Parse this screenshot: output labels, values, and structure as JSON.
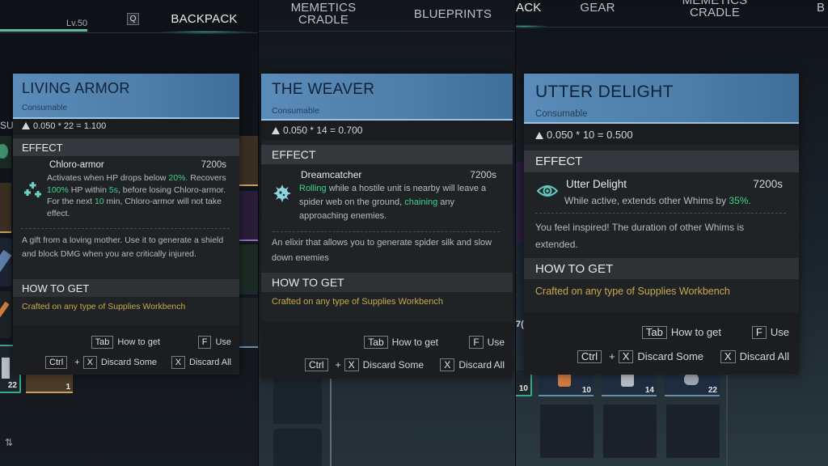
{
  "pane1": {
    "level": "Lv.50",
    "key_q": "Q",
    "active_tab": "BACKPACK",
    "partial_left_label": "SU",
    "slot_qty": [
      "22",
      "1"
    ],
    "sort_icon": "sort-icon",
    "card": {
      "title": "LIVING ARMOR",
      "type": "Consumable",
      "weight": "0.050 * 22 = 1.100",
      "effect_header": "EFFECT",
      "effect_name": "Chloro-armor",
      "effect_time": "7200s",
      "effect_icon": "plus-cluster-icon",
      "effect_desc": [
        {
          "t": "Activates when HP drops below ",
          "h": false
        },
        {
          "t": "20%.",
          "h": true
        },
        {
          "t": " Recovers ",
          "h": false
        },
        {
          "t": "100%",
          "h": true
        },
        {
          "t": " HP within ",
          "h": false
        },
        {
          "t": "5s",
          "h": true
        },
        {
          "t": ", before losing Chloro-armor. For the next ",
          "h": false
        },
        {
          "t": "10",
          "h": true
        },
        {
          "t": " min, Chloro-armor will not take effect.",
          "h": false
        }
      ],
      "flavor": "A gift from a loving mother. Use it to generate a shield and block DMG when you are critically injured.",
      "howto_header": "HOW TO GET",
      "howto": "Crafted on any type of Supplies Workbench"
    }
  },
  "pane2": {
    "tabs": [
      "MEMETICS\nCRADLE",
      "BLUEPRINTS"
    ],
    "card": {
      "title": "THE WEAVER",
      "type": "Consumable",
      "weight": "0.050 * 14 = 0.700",
      "effect_header": "EFFECT",
      "effect_name": "Dreamcatcher",
      "effect_time": "7200s",
      "effect_icon": "spiky-orb-icon",
      "effect_desc": [
        {
          "t": "Rolling",
          "h": true
        },
        {
          "t": " while a hostile unit is nearby will leave a spider web on the ground, ",
          "h": false
        },
        {
          "t": "chaining",
          "h": true
        },
        {
          "t": " any approaching enemies.",
          "h": false
        }
      ],
      "flavor": "An elixir that allows you to generate spider silk and slow down enemies",
      "howto_header": "HOW TO GET",
      "howto": "Crafted on any type of Supplies Workbench"
    }
  },
  "pane3": {
    "tabs": [
      "ACK",
      "GEAR",
      "MEMETICS\nCRADLE",
      "B"
    ],
    "slot_qty": [
      "10",
      "10",
      "14",
      "22"
    ],
    "partial_qty": "7(",
    "card": {
      "title": "UTTER DELIGHT",
      "type": "Consumable",
      "weight": "0.050 * 10 = 0.500",
      "effect_header": "EFFECT",
      "effect_name": "Utter Delight",
      "effect_time": "7200s",
      "effect_icon": "eye-icon",
      "effect_desc": [
        {
          "t": "While active, extends other Whims by ",
          "h": false
        },
        {
          "t": "35%.",
          "h": true
        }
      ],
      "flavor": "You feel inspired! The duration of other Whims is extended.",
      "howto_header": "HOW TO GET",
      "howto": "Crafted on any type of Supplies Workbench"
    }
  },
  "hints": {
    "tab_key": "Tab",
    "how_to_get": "How to get",
    "f_key": "F",
    "use": "Use",
    "ctrl_key": "Ctrl",
    "plus": "+",
    "x_key": "X",
    "discard_some": "Discard Some",
    "discard_all": "Discard All"
  },
  "colors": {
    "highlight": "#3fd08a",
    "howto": "#c8a94a",
    "header_blue": "#4d7ea8",
    "accent_teal": "#3fd6b9"
  }
}
